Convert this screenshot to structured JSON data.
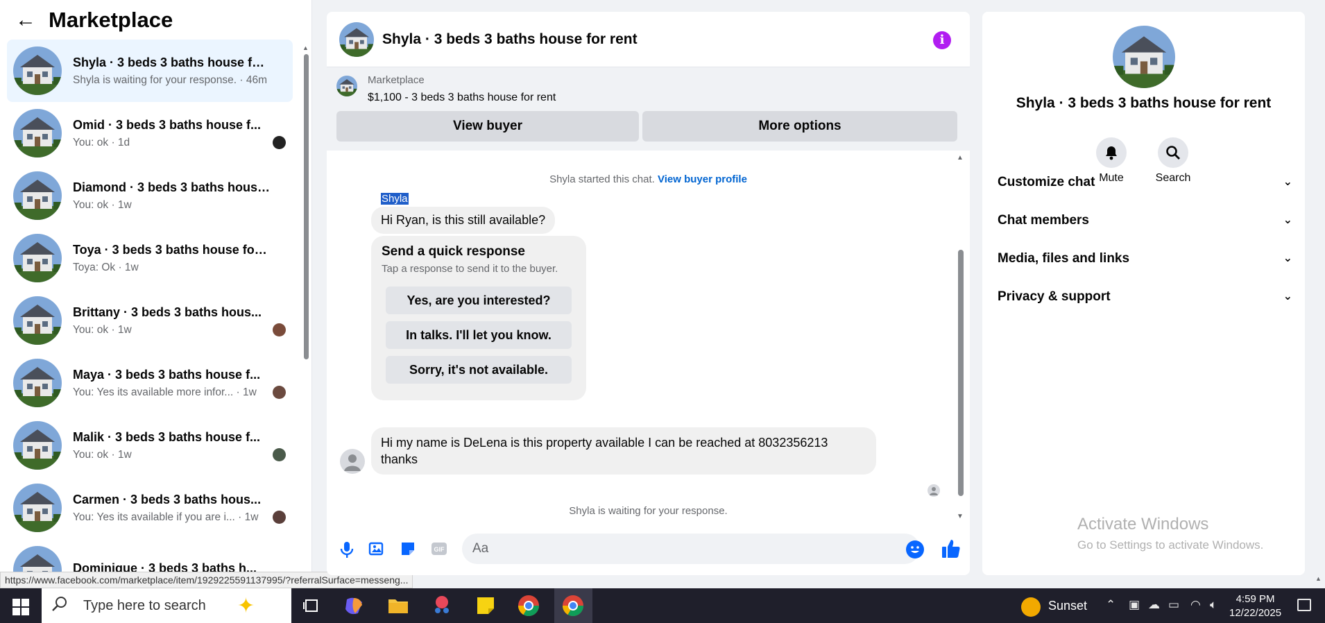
{
  "sidebar": {
    "title": "Marketplace",
    "conversations": [
      {
        "name": "Shyla · 3 beds 3 baths house for ...",
        "sub": "Shyla is waiting for your response. · 46m",
        "active": true
      },
      {
        "name": "Omid · 3 beds 3 baths house f...",
        "sub": "You: ok · 1d"
      },
      {
        "name": "Diamond · 3 beds 3 baths house...",
        "sub": "You: ok · 1w"
      },
      {
        "name": "Toya · 3 beds 3 baths house for r...",
        "sub": "Toya: Ok · 1w"
      },
      {
        "name": "Brittany · 3 beds 3 baths hous...",
        "sub": "You: ok · 1w"
      },
      {
        "name": "Maya · 3 beds 3 baths house f...",
        "sub": "You: Yes its available more infor... · 1w"
      },
      {
        "name": "Malik · 3 beds 3 baths house f...",
        "sub": "You: ok · 1w"
      },
      {
        "name": "Carmen · 3 beds 3 baths hous...",
        "sub": "You: Yes its available if you are i... · 1w"
      },
      {
        "name": "Dominique · 3 beds 3 baths h...",
        "sub": ""
      }
    ],
    "status_url": "https://www.facebook.com/marketplace/item/1929225591137995/?referralSurface=messeng..."
  },
  "chat": {
    "title": "Shyla · 3 beds 3 baths house for rent",
    "listing_source": "Marketplace",
    "listing_desc": "$1,100 - 3 beds 3 baths house for rent",
    "view_buyer": "View buyer",
    "more_options": "More options",
    "started_text": "Shyla started this chat.",
    "view_profile": "View buyer profile",
    "sender": "Shyla",
    "msg1": "Hi Ryan, is this still available?",
    "quick_title": "Send a quick response",
    "quick_sub": "Tap a response to send it to the buyer.",
    "quick_responses": [
      "Yes, are you interested?",
      "In talks. I'll let you know.",
      "Sorry, it's not available."
    ],
    "msg3": "Hi my name is DeLena is this property available I can be reached at 8032356213 thanks",
    "waiting": "Shyla is waiting for your response.",
    "input_placeholder": "Aa"
  },
  "panel": {
    "title": "Shyla · 3 beds 3 baths house for rent",
    "mute": "Mute",
    "search": "Search",
    "sections": [
      "Customize chat",
      "Chat members",
      "Media, files and links",
      "Privacy & support"
    ]
  },
  "watermark": {
    "line1": "Activate Windows",
    "line2": "Go to Settings to activate Windows."
  },
  "taskbar": {
    "search_placeholder": "Type here to search",
    "weather": "Sunset",
    "time": "4:59 PM",
    "date": "12/22/2025"
  },
  "colors": {
    "accent": "#0866ff",
    "active_conv": "#ebf5ff",
    "info_icon": "#b11df1"
  }
}
